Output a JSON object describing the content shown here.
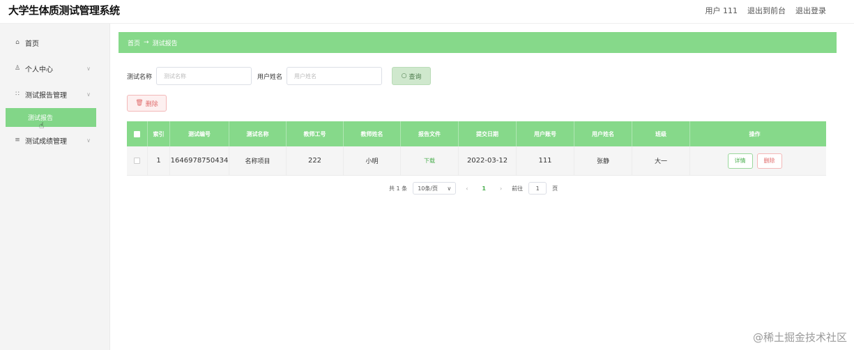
{
  "header": {
    "title": "大学生体质测试管理系统",
    "user_label": "用户 111",
    "back_to_front": "退出到前台",
    "logout": "退出登录"
  },
  "sidebar": {
    "items": [
      {
        "label": "首页",
        "icon": "home-icon"
      },
      {
        "label": "个人中心",
        "icon": "user-icon"
      },
      {
        "label": "测试报告管理",
        "icon": "grid-icon"
      },
      {
        "label": "测试成绩管理",
        "icon": "chart-icon"
      }
    ],
    "active_sub": "测试报告"
  },
  "breadcrumb": {
    "home": "首页",
    "arrow": "→",
    "current": "测试报告"
  },
  "search": {
    "name_label": "测试名称",
    "name_placeholder": "测试名称",
    "user_label": "用户姓名",
    "user_placeholder": "用户姓名",
    "query_button": "查询"
  },
  "delete_button": "删除",
  "table": {
    "headers": [
      "索引",
      "测试编号",
      "测试名称",
      "教师工号",
      "教师姓名",
      "报告文件",
      "提交日期",
      "用户账号",
      "用户姓名",
      "班级",
      "操作"
    ],
    "rows": [
      {
        "index": "1",
        "test_no": "1646978750434",
        "test_name": "名称项目",
        "teacher_no": "222",
        "teacher_name": "小明",
        "report_file": "下载",
        "submit_date": "2022-03-12",
        "user_account": "111",
        "user_name": "张静",
        "class": "大一",
        "detail": "详情",
        "delete": "删除"
      }
    ]
  },
  "pagination": {
    "total": "共 1 条",
    "page_size": "10条/页",
    "current_page": "1",
    "goto_label": "前往",
    "goto_value": "1",
    "page_unit": "页"
  },
  "watermark": "@稀土掘金技术社区",
  "colors": {
    "accent": "#86d98a",
    "danger": "#e06c6c",
    "link": "#4caf50"
  }
}
